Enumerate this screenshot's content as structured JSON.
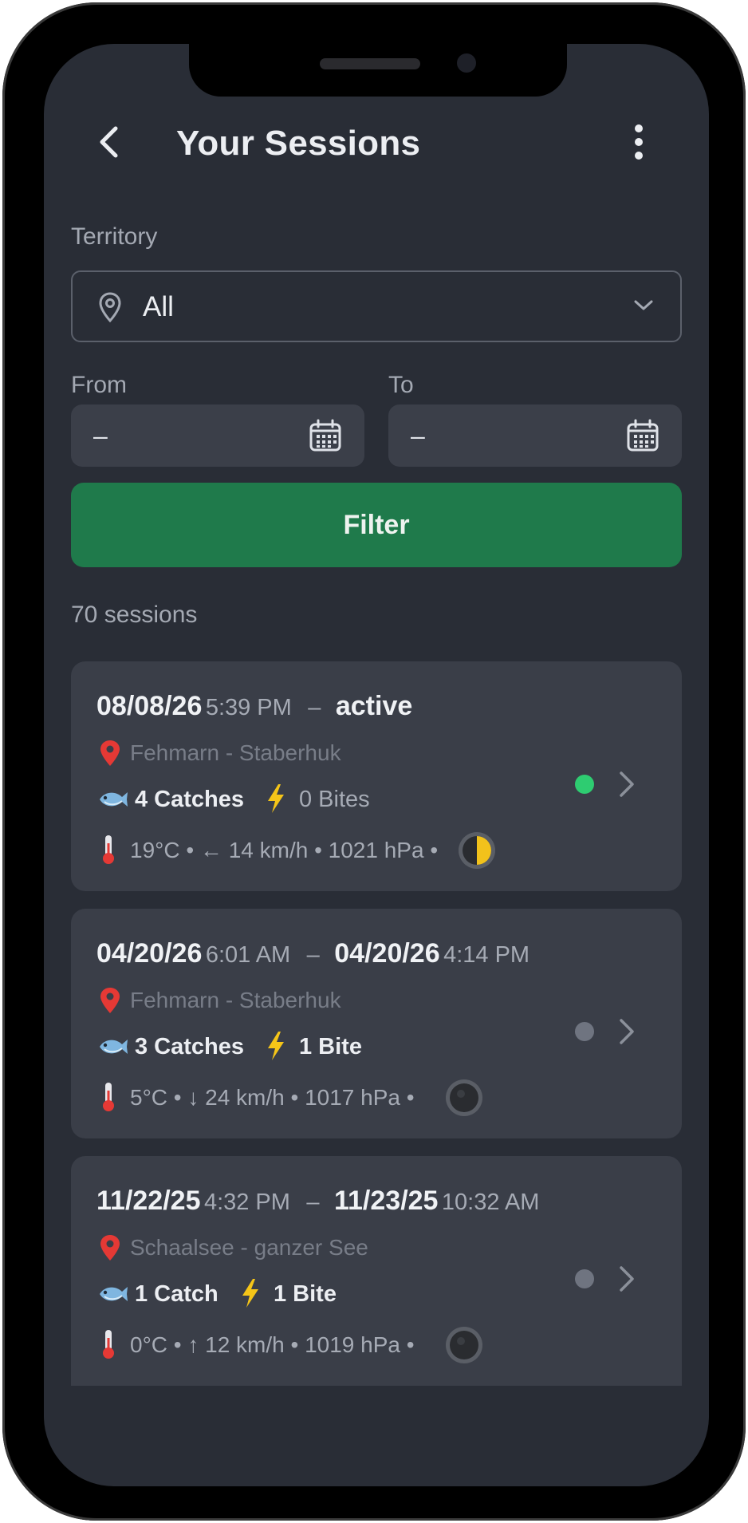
{
  "header": {
    "title": "Your Sessions",
    "back_icon": "chevron-left-icon",
    "menu_icon": "more-vertical-icon"
  },
  "filters": {
    "territory_label": "Territory",
    "territory_value": "All",
    "from_label": "From",
    "from_value": "–",
    "to_label": "To",
    "to_value": "–",
    "filter_button": "Filter"
  },
  "session_count": "70 sessions",
  "sessions": [
    {
      "start_date": "08/08/26",
      "start_time": "5:39 PM",
      "separator": "–",
      "end_label": "active",
      "end_date": "",
      "end_time": "",
      "location": "Fehmarn - Staberhuk",
      "catches": "4 Catches",
      "bites": "0 Bites",
      "weather": "19°C • ← 14 km/h • 1021 hPa •",
      "moon_phase": "first-quarter",
      "status": "active"
    },
    {
      "start_date": "04/20/26",
      "start_time": "6:01 AM",
      "separator": "–",
      "end_label": "",
      "end_date": "04/20/26",
      "end_time": "4:14 PM",
      "location": "Fehmarn - Staberhuk",
      "catches": "3 Catches",
      "bites": "1 Bite",
      "weather": "5°C • ↓ 24 km/h • 1017 hPa •",
      "moon_phase": "new",
      "status": "inactive"
    },
    {
      "start_date": "11/22/25",
      "start_time": "4:32 PM",
      "separator": "–",
      "end_label": "",
      "end_date": "11/23/25",
      "end_time": "10:32 AM",
      "location": "Schaalsee - ganzer See",
      "catches": "1 Catch",
      "bites": "1 Bite",
      "weather": "0°C • ↑ 12 km/h • 1019 hPa •",
      "moon_phase": "new",
      "status": "inactive"
    }
  ],
  "colors": {
    "background": "#292d36",
    "card": "#3a3e48",
    "accent_green": "#1f7a4b",
    "active_dot": "#2ecc71",
    "pin_red": "#e53935"
  }
}
